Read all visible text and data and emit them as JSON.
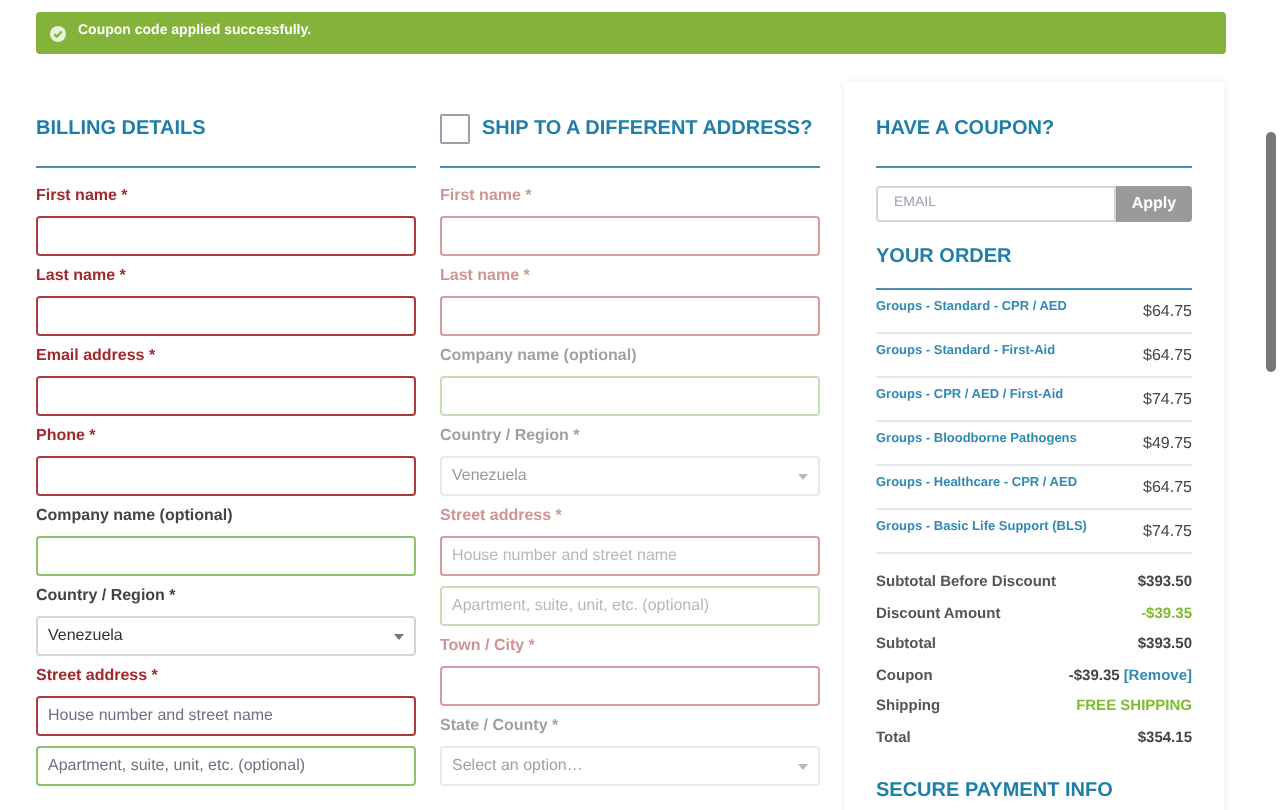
{
  "notice": {
    "text": "Coupon code applied successfully."
  },
  "billing": {
    "title": "BILLING DETAILS",
    "disabled": false,
    "fields": [
      {
        "label": "First name *",
        "kind": "input",
        "invalid": true
      },
      {
        "label": "Last name *",
        "kind": "input",
        "invalid": true
      },
      {
        "label": "Email address *",
        "kind": "input",
        "invalid": true
      },
      {
        "label": "Phone *",
        "kind": "input",
        "invalid": true
      },
      {
        "label": "Company name (optional)",
        "kind": "input",
        "invalid": false
      },
      {
        "label": "Country / Region *",
        "kind": "select",
        "invalid": false,
        "value": "Venezuela"
      },
      {
        "label": "Street address *",
        "kind": "input",
        "invalid": true,
        "placeholder": "House number and street name"
      },
      {
        "kind": "input",
        "invalid": false,
        "placeholder": "Apartment, suite, unit, etc. (optional)"
      }
    ]
  },
  "shipping": {
    "title": "SHIP TO A DIFFERENT ADDRESS?",
    "checked": false,
    "disabled": true,
    "fields": [
      {
        "label": "First name *",
        "kind": "input",
        "invalid": true
      },
      {
        "label": "Last name *",
        "kind": "input",
        "invalid": true
      },
      {
        "label": "Company name (optional)",
        "kind": "input",
        "invalid": false
      },
      {
        "label": "Country / Region *",
        "kind": "select",
        "invalid": false,
        "value": "Venezuela"
      },
      {
        "label": "Street address *",
        "kind": "input",
        "invalid": true,
        "placeholder": "House number and street name"
      },
      {
        "kind": "input",
        "invalid": false,
        "placeholder": "Apartment, suite, unit, etc. (optional)"
      },
      {
        "label": "Town / City *",
        "kind": "input",
        "invalid": true
      },
      {
        "label": "State / County *",
        "kind": "select",
        "invalid": false,
        "placeholder": "Select an option…"
      }
    ]
  },
  "coupon": {
    "title": "HAVE A COUPON?",
    "placeholder": "EMAIL",
    "button": "Apply"
  },
  "order": {
    "title": "YOUR ORDER",
    "items": [
      {
        "name": "Groups - Standard - CPR / AED",
        "price": "$64.75"
      },
      {
        "name": "Groups - Standard - First-Aid",
        "price": "$64.75"
      },
      {
        "name": "Groups - CPR / AED / First-Aid",
        "price": "$74.75"
      },
      {
        "name": "Groups - Bloodborne Pathogens",
        "price": "$49.75"
      },
      {
        "name": "Groups - Healthcare - CPR / AED",
        "price": "$64.75"
      },
      {
        "name": "Groups - Basic Life Support (BLS)",
        "price": "$74.75"
      }
    ],
    "totals": [
      {
        "label": "Subtotal Before Discount",
        "value": "$393.50",
        "kind": "plain"
      },
      {
        "label": "Discount Amount",
        "value": "-$39.35",
        "kind": "highlight"
      },
      {
        "label": "Subtotal",
        "value": "$393.50",
        "kind": "plain"
      },
      {
        "label": "Coupon",
        "value": "-$39.35",
        "link": "[Remove]",
        "kind": "plain"
      },
      {
        "label": "Shipping",
        "value": "FREE SHIPPING",
        "kind": "highlight"
      },
      {
        "label": "Total",
        "value": "$354.15",
        "kind": "plain"
      }
    ]
  },
  "payment": {
    "title": "SECURE PAYMENT INFO"
  }
}
